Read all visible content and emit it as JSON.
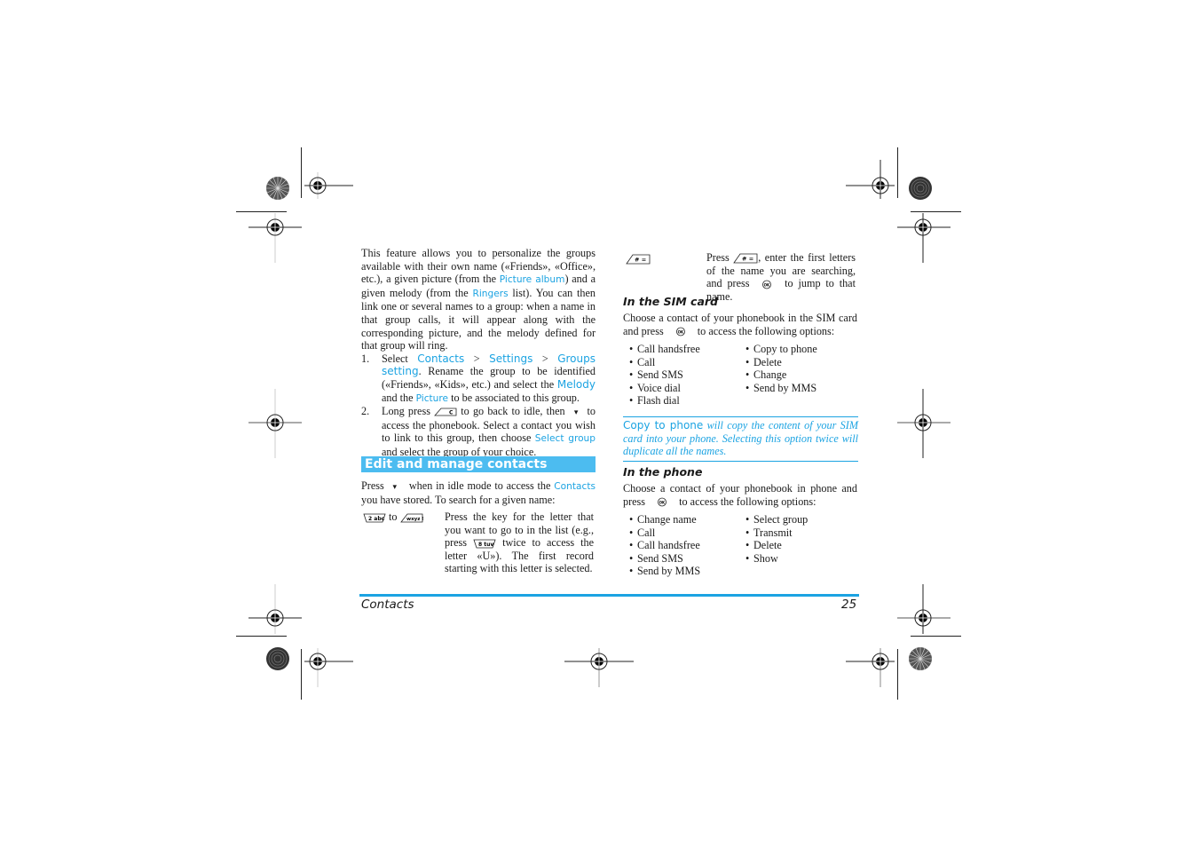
{
  "intro": {
    "parts": [
      "This feature allows you to personalize the groups available with their own name («Friends», «Office», etc.), a given picture (from the ",
      "Picture album",
      ") and a given melody (from the ",
      "Ringers",
      " list). You can then link one or several names to a group: when a name in that group calls, it will appear along with the corresponding picture, and the melody defined for that group will ring."
    ]
  },
  "steps": [
    {
      "number": "1.",
      "parts": [
        "Select ",
        "Contacts",
        " > ",
        "Settings",
        " > ",
        "Groups setting",
        ". Rename the group to be identified («Friends», «Kids», etc.) and select the ",
        "Melody",
        " and the ",
        "Picture",
        " to be associated to this group."
      ]
    },
    {
      "number": "2.",
      "parts": [
        "Long press ",
        " to go back to idle, then ",
        " to access the phonebook. Select a contact you wish to link to this group, then choose ",
        "Select group",
        " and select the group of your choice."
      ]
    }
  ],
  "section": {
    "heading": "Edit and manage contacts",
    "press_parts": [
      "Press ",
      " when in idle mode to access the ",
      "Contacts",
      " you have stored. To search for a given name:"
    ],
    "search_rows": [
      {
        "key_label_from": "2 abc",
        "key_connector": "to",
        "key_label_to": "wxyz 9",
        "desc_parts": [
          "Press the key for the letter that you want to go to in the list (e.g., press ",
          " twice to access the letter «U»). The first record starting with this letter is selected."
        ],
        "inline_key": "8 tuv"
      },
      {
        "key_label": "# =",
        "desc_parts": [
          "Press ",
          ", enter the first letters of the name you are searching, and press ",
          " to jump to that name."
        ],
        "ok_label": "OK"
      }
    ]
  },
  "sim_card": {
    "heading": "In the SIM card",
    "intro_parts": [
      "Choose a contact of your phonebook in the SIM card and press ",
      " to access the following options:"
    ],
    "options_col1": [
      "Call handsfree",
      "Call",
      "Send SMS",
      "Voice dial",
      "Flash dial"
    ],
    "options_col2": [
      "Copy to phone",
      "Delete",
      "Change",
      "Send by MMS"
    ]
  },
  "note": {
    "link": "Copy to phone",
    "text": " will copy the content of your SIM card into your phone. Selecting this option twice will duplicate all the names."
  },
  "phone": {
    "heading": "In the phone",
    "intro_parts": [
      "Choose a contact of your phonebook in phone and press ",
      " to access the following options:"
    ],
    "options_col1": [
      "Change name",
      "Call",
      "Call handsfree",
      "Send SMS",
      "Send by MMS"
    ],
    "options_col2": [
      "Select group",
      "Transmit",
      "Delete",
      "Show"
    ]
  },
  "footer": {
    "section": "Contacts",
    "page": "25"
  },
  "icons": {
    "c_key": "C",
    "down_arrow": "▾",
    "ok_button": "OK"
  },
  "colors": {
    "accent": "#1ba3e2",
    "heading_bar": "#4cbcf0"
  }
}
